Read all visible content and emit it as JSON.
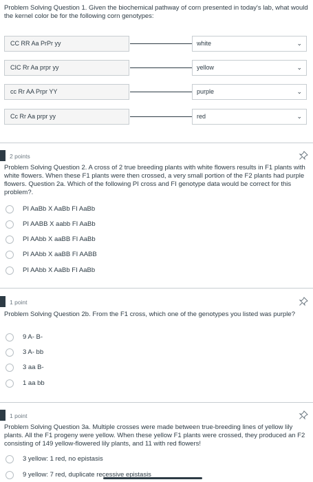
{
  "q1": {
    "text": "Problem Solving Question 1. Given the biochemical pathway of corn presented in today's lab, what would the kernel color be for the following corn genotypes:",
    "matches": [
      {
        "left": "CC RR Aa PrPr yy",
        "answer": "white"
      },
      {
        "left": "CIC Rr Aa prpr yy",
        "answer": "yellow"
      },
      {
        "left": "cc Rr AA Prpr YY",
        "answer": "purple"
      },
      {
        "left": "Cc Rr Aa prpr yy",
        "answer": "red"
      }
    ]
  },
  "q2": {
    "points": "2 points",
    "text": "Problem Solving Question 2. A cross of 2 true breeding plants with white flowers results in F1 plants with white flowers. When these F1 plants were then crossed, a very small portion of the F2 plants had purple flowers. Question 2a. Which of the following PI cross and FI genotype data would be correct for this problem?.",
    "options": [
      "PI AaBb X AaBb  FI AaBb",
      "PI AABB X aabb  FI AaBb",
      "PI AAbb X aaBB  FI AaBb",
      "PI AAbb X aaBB  FI AABB",
      "PI AAbb X AaBb  FI AaBb"
    ]
  },
  "q3": {
    "points": "1 point",
    "text": "Problem Solving Question 2b. From the F1 cross, which one of the genotypes you listed was purple?",
    "options": [
      "9 A- B-",
      "3 A- bb",
      "3 aa B-",
      "1 aa bb"
    ]
  },
  "q4": {
    "points": "1 point",
    "text": "Problem Solving Question 3a. Multiple crosses were made between true-breeding lines of yellow lily plants. All the F1 progeny were yellow. When these yellow F1 plants were crossed, they produced an F2 consisting of 149 yellow-flowered lily plants, and 11 with red flowers!",
    "options": [
      "3 yellow: 1 red, no epistasis",
      "9 yellow: 7 red, duplicate recessive epistasis"
    ]
  },
  "icons": {
    "chevron": "chevron-down-icon",
    "pin": "pin-icon"
  }
}
